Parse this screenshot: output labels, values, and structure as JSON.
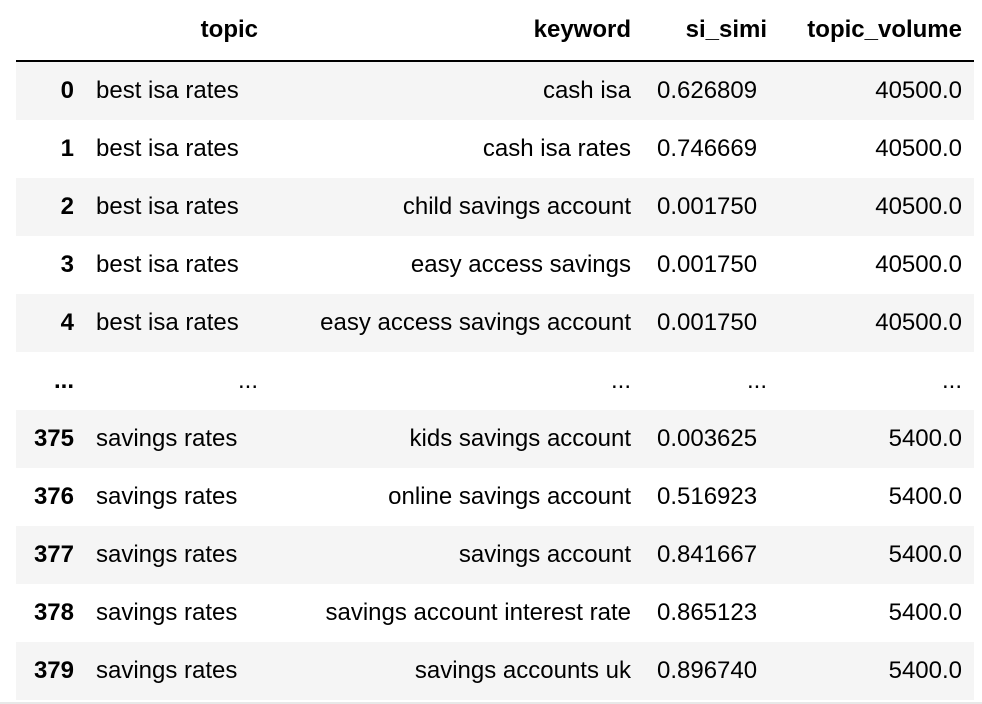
{
  "dataframe": {
    "columns": {
      "index": "",
      "topic": "topic",
      "keyword": "keyword",
      "si_simi": "si_simi",
      "topic_volume": "topic_volume"
    },
    "rows": [
      {
        "index": "0",
        "topic": "best isa rates",
        "keyword": "cash isa",
        "si_simi": "0.626809",
        "topic_volume": "40500.0"
      },
      {
        "index": "1",
        "topic": "best isa rates",
        "keyword": "cash isa rates",
        "si_simi": "0.746669",
        "topic_volume": "40500.0"
      },
      {
        "index": "2",
        "topic": "best isa rates",
        "keyword": "child savings account",
        "si_simi": "0.001750",
        "topic_volume": "40500.0"
      },
      {
        "index": "3",
        "topic": "best isa rates",
        "keyword": "easy access savings",
        "si_simi": "0.001750",
        "topic_volume": "40500.0"
      },
      {
        "index": "4",
        "topic": "best isa rates",
        "keyword": "easy access savings account",
        "si_simi": "0.001750",
        "topic_volume": "40500.0"
      },
      {
        "index": "...",
        "topic": "...",
        "keyword": "...",
        "si_simi": "...",
        "topic_volume": "...",
        "ellipsis": true
      },
      {
        "index": "375",
        "topic": "savings rates",
        "keyword": "kids savings account",
        "si_simi": "0.003625",
        "topic_volume": "5400.0"
      },
      {
        "index": "376",
        "topic": "savings rates",
        "keyword": "online savings account",
        "si_simi": "0.516923",
        "topic_volume": "5400.0"
      },
      {
        "index": "377",
        "topic": "savings rates",
        "keyword": "savings account",
        "si_simi": "0.841667",
        "topic_volume": "5400.0"
      },
      {
        "index": "378",
        "topic": "savings rates",
        "keyword": "savings account interest rate",
        "si_simi": "0.865123",
        "topic_volume": "5400.0"
      },
      {
        "index": "379",
        "topic": "savings rates",
        "keyword": "savings accounts uk",
        "si_simi": "0.896740",
        "topic_volume": "5400.0"
      }
    ]
  },
  "colors": {
    "stripe": "#f5f5f5",
    "header_rule": "#000000",
    "text": "#000000"
  }
}
